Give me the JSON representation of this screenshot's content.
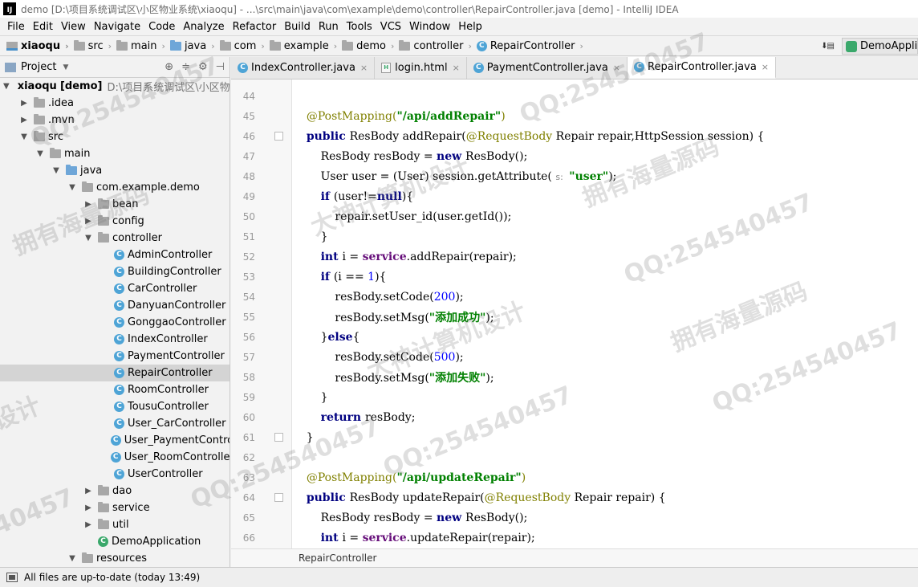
{
  "window": {
    "title": "demo [D:\\项目系统调试区\\小区物业系统\\xiaoqu] - ...\\src\\main\\java\\com\\example\\demo\\controller\\RepairController.java [demo] - IntelliJ IDEA",
    "logo": "IJ"
  },
  "menu": [
    "File",
    "Edit",
    "View",
    "Navigate",
    "Code",
    "Analyze",
    "Refactor",
    "Build",
    "Run",
    "Tools",
    "VCS",
    "Window",
    "Help"
  ],
  "breadcrumbs": [
    "xiaoqu",
    "src",
    "main",
    "java",
    "com",
    "example",
    "demo",
    "controller",
    "RepairController"
  ],
  "run_config": "DemoApplication",
  "project_panel": {
    "title": "Project",
    "root_name": "xiaoqu",
    "root_module": "[demo]",
    "root_path": "D:\\项目系统调试区\\小区物业系统",
    "tree": [
      {
        "label": ".idea",
        "level": 1,
        "arrow": "▶",
        "icon": "folder"
      },
      {
        "label": ".mvn",
        "level": 1,
        "arrow": "▶",
        "icon": "folder"
      },
      {
        "label": "src",
        "level": 1,
        "arrow": "▼",
        "icon": "folder"
      },
      {
        "label": "main",
        "level": 2,
        "arrow": "▼",
        "icon": "folder"
      },
      {
        "label": "java",
        "level": 3,
        "arrow": "▼",
        "icon": "folder-blue"
      },
      {
        "label": "com.example.demo",
        "level": 4,
        "arrow": "▼",
        "icon": "folder"
      },
      {
        "label": "bean",
        "level": 5,
        "arrow": "▶",
        "icon": "folder"
      },
      {
        "label": "config",
        "level": 5,
        "arrow": "▶",
        "icon": "folder"
      },
      {
        "label": "controller",
        "level": 5,
        "arrow": "▼",
        "icon": "folder"
      },
      {
        "label": "AdminController",
        "level": 6,
        "arrow": "",
        "icon": "class"
      },
      {
        "label": "BuildingController",
        "level": 6,
        "arrow": "",
        "icon": "class"
      },
      {
        "label": "CarController",
        "level": 6,
        "arrow": "",
        "icon": "class"
      },
      {
        "label": "DanyuanController",
        "level": 6,
        "arrow": "",
        "icon": "class"
      },
      {
        "label": "GonggaoController",
        "level": 6,
        "arrow": "",
        "icon": "class"
      },
      {
        "label": "IndexController",
        "level": 6,
        "arrow": "",
        "icon": "class"
      },
      {
        "label": "PaymentController",
        "level": 6,
        "arrow": "",
        "icon": "class"
      },
      {
        "label": "RepairController",
        "level": 6,
        "arrow": "",
        "icon": "class",
        "selected": true
      },
      {
        "label": "RoomController",
        "level": 6,
        "arrow": "",
        "icon": "class"
      },
      {
        "label": "TousuController",
        "level": 6,
        "arrow": "",
        "icon": "class"
      },
      {
        "label": "User_CarController",
        "level": 6,
        "arrow": "",
        "icon": "class"
      },
      {
        "label": "User_PaymentControll",
        "level": 6,
        "arrow": "",
        "icon": "class"
      },
      {
        "label": "User_RoomController",
        "level": 6,
        "arrow": "",
        "icon": "class"
      },
      {
        "label": "UserController",
        "level": 6,
        "arrow": "",
        "icon": "class"
      },
      {
        "label": "dao",
        "level": 5,
        "arrow": "▶",
        "icon": "folder"
      },
      {
        "label": "service",
        "level": 5,
        "arrow": "▶",
        "icon": "folder"
      },
      {
        "label": "util",
        "level": 5,
        "arrow": "▶",
        "icon": "folder"
      },
      {
        "label": "DemoApplication",
        "level": 5,
        "arrow": "",
        "icon": "class-green"
      },
      {
        "label": "resources",
        "level": 4,
        "arrow": "▼",
        "icon": "folder"
      }
    ]
  },
  "tabs": [
    {
      "label": "IndexController.java",
      "icon": "class",
      "active": false
    },
    {
      "label": "login.html",
      "icon": "html",
      "active": false
    },
    {
      "label": "PaymentController.java",
      "icon": "class",
      "active": false
    },
    {
      "label": "RepairController.java",
      "icon": "class",
      "active": true
    }
  ],
  "code": [
    {
      "n": "44",
      "tokens": []
    },
    {
      "n": "45",
      "tokens": [
        [
          "    ",
          ""
        ],
        [
          "@PostMapping(",
          "ann"
        ],
        [
          "\"/api/addRepair\"",
          "str"
        ],
        [
          ")",
          "ann"
        ]
      ]
    },
    {
      "n": "46",
      "fold": true,
      "tokens": [
        [
          "    ",
          ""
        ],
        [
          "public ",
          "kw"
        ],
        [
          "ResBody addRepair(",
          ""
        ],
        [
          "@RequestBody ",
          "ann"
        ],
        [
          "Repair repair,HttpSession session) {",
          ""
        ]
      ]
    },
    {
      "n": "47",
      "tokens": [
        [
          "        ResBody resBody = ",
          ""
        ],
        [
          "new ",
          "kw"
        ],
        [
          "ResBody();",
          ""
        ]
      ]
    },
    {
      "n": "48",
      "tokens": [
        [
          "        User user = (User) session.getAttribute( ",
          ""
        ],
        [
          "s: ",
          "hint"
        ],
        [
          "\"user\"",
          "str"
        ],
        [
          ");",
          ""
        ]
      ]
    },
    {
      "n": "49",
      "tokens": [
        [
          "        ",
          ""
        ],
        [
          "if ",
          "kw"
        ],
        [
          "(user!=",
          ""
        ],
        [
          "null",
          "kw"
        ],
        [
          "){",
          ""
        ]
      ]
    },
    {
      "n": "50",
      "tokens": [
        [
          "            repair.setUser_id(user.getId());",
          ""
        ]
      ]
    },
    {
      "n": "51",
      "tokens": [
        [
          "        }",
          ""
        ]
      ]
    },
    {
      "n": "52",
      "tokens": [
        [
          "        ",
          ""
        ],
        [
          "int ",
          "kw"
        ],
        [
          "i = ",
          ""
        ],
        [
          "service",
          "fld"
        ],
        [
          ".addRepair(repair);",
          ""
        ]
      ]
    },
    {
      "n": "53",
      "tokens": [
        [
          "        ",
          ""
        ],
        [
          "if ",
          "kw"
        ],
        [
          "(i == ",
          ""
        ],
        [
          "1",
          "num"
        ],
        [
          "){",
          ""
        ]
      ]
    },
    {
      "n": "54",
      "tokens": [
        [
          "            resBody.setCode(",
          ""
        ],
        [
          "200",
          "num"
        ],
        [
          ");",
          ""
        ]
      ]
    },
    {
      "n": "55",
      "tokens": [
        [
          "            resBody.setMsg(",
          ""
        ],
        [
          "\"添加成功\"",
          "str"
        ],
        [
          ");",
          ""
        ]
      ]
    },
    {
      "n": "56",
      "tokens": [
        [
          "        }",
          ""
        ],
        [
          "else",
          "kw"
        ],
        [
          "{",
          ""
        ]
      ]
    },
    {
      "n": "57",
      "tokens": [
        [
          "            resBody.setCode(",
          ""
        ],
        [
          "500",
          "num"
        ],
        [
          ");",
          ""
        ]
      ]
    },
    {
      "n": "58",
      "tokens": [
        [
          "            resBody.setMsg(",
          ""
        ],
        [
          "\"添加失败\"",
          "str"
        ],
        [
          ");",
          ""
        ]
      ]
    },
    {
      "n": "59",
      "tokens": [
        [
          "        }",
          ""
        ]
      ]
    },
    {
      "n": "60",
      "tokens": [
        [
          "        ",
          ""
        ],
        [
          "return ",
          "kw"
        ],
        [
          "resBody;",
          ""
        ]
      ]
    },
    {
      "n": "61",
      "fold": true,
      "tokens": [
        [
          "    }",
          ""
        ]
      ]
    },
    {
      "n": "62",
      "tokens": []
    },
    {
      "n": "63",
      "tokens": [
        [
          "    ",
          ""
        ],
        [
          "@PostMapping(",
          "ann"
        ],
        [
          "\"/api/updateRepair\"",
          "str"
        ],
        [
          ")",
          "ann"
        ]
      ]
    },
    {
      "n": "64",
      "fold": true,
      "tokens": [
        [
          "    ",
          ""
        ],
        [
          "public ",
          "kw"
        ],
        [
          "ResBody updateRepair(",
          ""
        ],
        [
          "@RequestBody ",
          "ann"
        ],
        [
          "Repair repair) {",
          ""
        ]
      ]
    },
    {
      "n": "65",
      "tokens": [
        [
          "        ResBody resBody = ",
          ""
        ],
        [
          "new ",
          "kw"
        ],
        [
          "ResBody();",
          ""
        ]
      ]
    },
    {
      "n": "66",
      "tokens": [
        [
          "        ",
          ""
        ],
        [
          "int ",
          "kw"
        ],
        [
          "i = ",
          ""
        ],
        [
          "service",
          "fld"
        ],
        [
          ".updateRepair(repair);",
          ""
        ]
      ]
    }
  ],
  "editor_breadcrumb": "RepairController",
  "status": {
    "message": "All files are up-to-date (today 13:49)"
  },
  "watermarks": [
    {
      "text": "QQ:254540457"
    },
    {
      "text": "拥有海量源码"
    },
    {
      "text": "大神计算机设计"
    },
    {
      "text": "QQ:254540457"
    },
    {
      "text": "拥有海量源码"
    },
    {
      "text": "QQ:254540457"
    },
    {
      "text": "大神计算机设计"
    },
    {
      "text": "QQ:254540457"
    },
    {
      "text": "拥有海量源码"
    },
    {
      "text": "QQ:254540457"
    },
    {
      "text": "设计"
    },
    {
      "text": "QQ:254540457"
    },
    {
      "text": "40457"
    }
  ]
}
